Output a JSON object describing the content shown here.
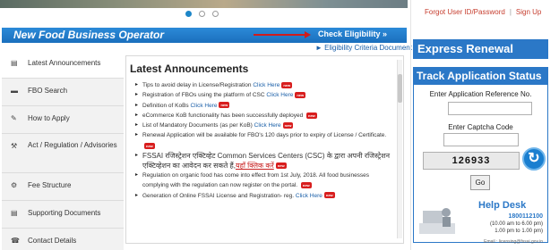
{
  "carousel": {
    "dots": 3,
    "active_index": 0
  },
  "bar": {
    "title": "New Food Business Operator",
    "check_label": "Check Eligibility »",
    "eligibility_link": "Eligibility Criteria Document"
  },
  "nav": [
    {
      "label": "Latest Announcements",
      "icon": "megaphone-icon",
      "glyph": "▤"
    },
    {
      "label": "FBO Search",
      "icon": "chat-icon",
      "glyph": "▬"
    },
    {
      "label": "How to Apply",
      "icon": "pencil-icon",
      "glyph": "✎"
    },
    {
      "label": "Act / Regulation / Advisories",
      "icon": "gavel-icon",
      "glyph": "⚒"
    },
    {
      "label": "Fee Structure",
      "icon": "gear-icon",
      "glyph": "⚙"
    },
    {
      "label": "Supporting Documents",
      "icon": "document-icon",
      "glyph": "▤"
    },
    {
      "label": "Contact Details",
      "icon": "phone-icon",
      "glyph": "☎"
    }
  ],
  "announcements": {
    "heading": "Latest Announcements",
    "click_here": "Click Here",
    "new_badge": "new",
    "items": [
      {
        "text": "Tips to avoid delay in License/Registration ",
        "link": true,
        "new": true
      },
      {
        "text": "Registration of FBOs using the platform of CSC ",
        "link": true,
        "new": true
      },
      {
        "text": "Definition of KoBs ",
        "link": true,
        "new": true
      },
      {
        "text": "eCommerce KoB functionality has been successfully deployed ",
        "link": false,
        "new": true
      },
      {
        "text": "List of Mandatory Documents (as per KoB) ",
        "link": true,
        "new": true
      },
      {
        "text": "Renewal Application will be available for FBO's 120 days prior to expiry of License / Certificate. ",
        "link": false,
        "new": true
      },
      {
        "text": "FSSAI रजिस्ट्रेशन एक्टिव्हेट Common Services Centers (CSC) के द्वारा अपनी रजिस्ट्रेशन एक्टिव्हेशन का आवेदन कर सकते हैं,",
        "hindi_link": "यहाँ क्लिक करें",
        "new": true,
        "hindi": true
      },
      {
        "text": "Regulation on organic food has come into effect from 1st July, 2018. All food businesses complying with the regulation can now register on the portal. ",
        "link": false,
        "new": true
      },
      {
        "text": "Generation of Online FSSAI License and Registration- reg. ",
        "link": true,
        "new": true
      }
    ]
  },
  "top_links": {
    "forgot": "Forgot User ID/Password",
    "separator": "|",
    "signup": "Sign Up"
  },
  "express": "Express Renewal",
  "track": {
    "title": "Track Application Status",
    "ref_label": "Enter Application Reference No.",
    "captcha_label": "Enter Captcha Code",
    "captcha_value": "126933",
    "go": "Go"
  },
  "helpdesk": {
    "title": "Help Desk",
    "phone": "1800112100",
    "line1": "(10.00 am to 6.00 pm)",
    "line2": "1.00 pm to 1.00 pm)",
    "email": "Email : licensing@fssai.gov.in"
  },
  "colors": {
    "blue": "#2b78c7",
    "accent_red": "#d01c1c",
    "link": "#1a5fa8"
  }
}
